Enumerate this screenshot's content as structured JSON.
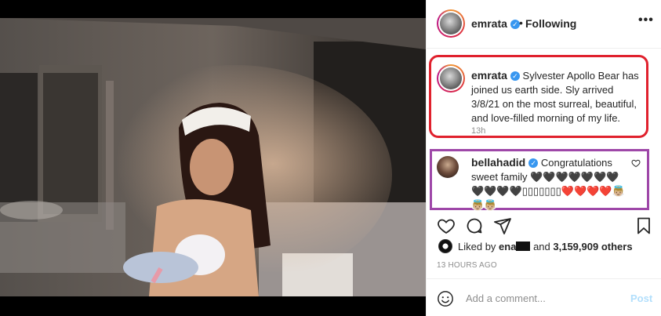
{
  "post": {
    "username": "emrata",
    "separator": "•",
    "follow_status": "Following",
    "more_label": "•••",
    "caption_username": "emrata",
    "caption": "Sylvester Apollo Bear has joined us earth side. Sly arrived 3/8/21 on the most surreal, beautiful, and love-filled morning of my life.",
    "caption_age": "13h"
  },
  "comment": {
    "username": "bellahadid",
    "text": "Congratulations sweet family 🖤🖤🖤🖤🖤🖤🖤🖤🖤🖤🖤▯▯▯▯▯▯▯❤️❤️❤️❤️👼🏼👼🏼👼🏼"
  },
  "likes": {
    "prefix": "Liked by ",
    "first_user": "ena",
    "middle": " and ",
    "count": "3,159,909 others"
  },
  "timestamp": "13 HOURS AGO",
  "comment_input": {
    "placeholder": "Add a comment...",
    "post_label": "Post"
  },
  "icons": [
    "like-icon",
    "comment-icon",
    "share-icon",
    "save-icon",
    "emoji-icon",
    "more-icon",
    "verified-badge-icon",
    "comment-like-icon"
  ],
  "colors": {
    "caption_highlight": "#e0212d",
    "comment_highlight": "#9e47a8",
    "verified": "#3897f0",
    "post_button": "#b2dffc"
  }
}
